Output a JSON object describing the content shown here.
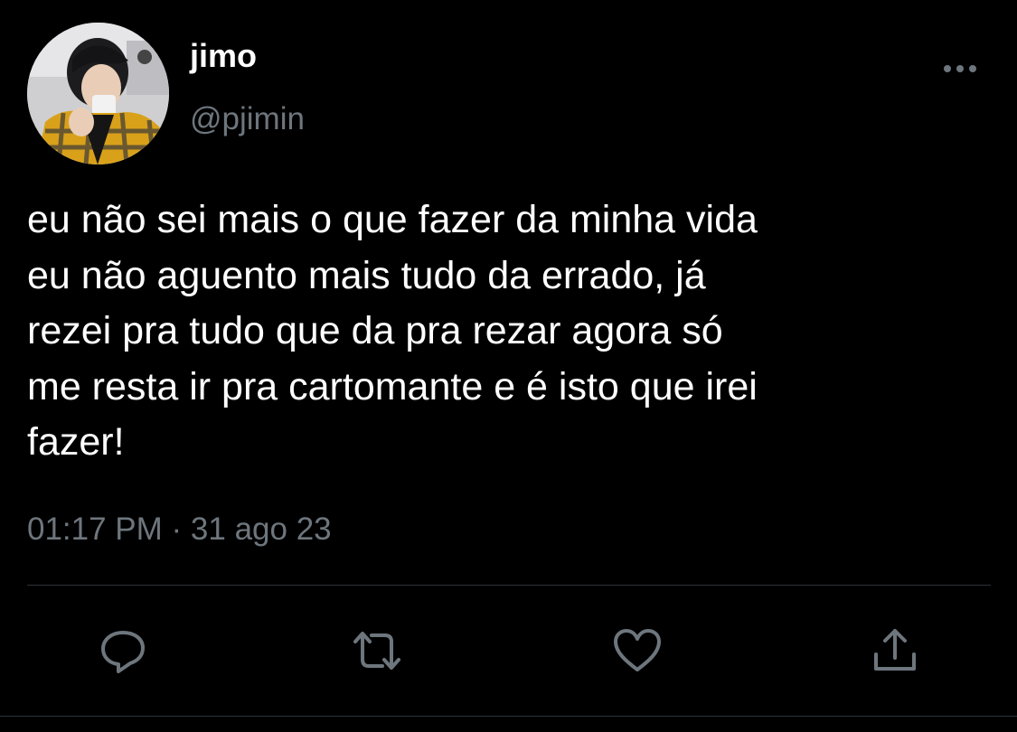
{
  "user": {
    "display_name": "jimo",
    "handle": "@pjimin"
  },
  "tweet": {
    "text": "eu não sei mais o que fazer da minha vida\neu não aguento mais tudo da errado, já\nrezei pra tudo que da pra rezar agora só\nme resta ir pra cartomante e é isto que irei\nfazer!",
    "timestamp": "01:17 PM · 31 ago 23"
  },
  "actions": [
    {
      "icon": "reply-icon"
    },
    {
      "icon": "retweet-icon"
    },
    {
      "icon": "like-icon"
    },
    {
      "icon": "share-icon"
    }
  ],
  "colors": {
    "background": "#000000",
    "text": "#ffffff",
    "secondary_text": "#6e767d",
    "divider": "#2f3336"
  }
}
